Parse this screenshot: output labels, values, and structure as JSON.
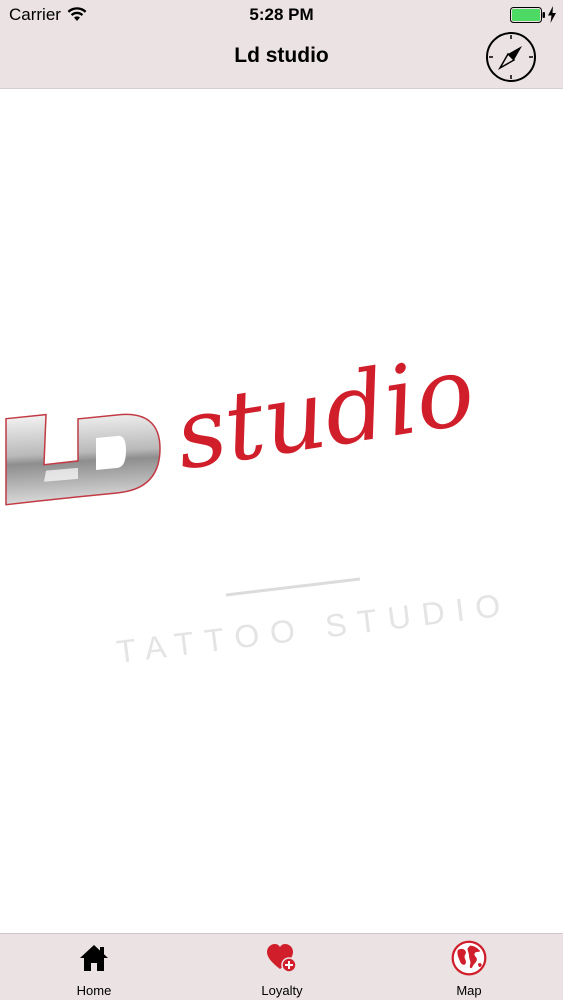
{
  "status_bar": {
    "carrier": "Carrier",
    "time": "5:28 PM",
    "battery_color": "#4cd964"
  },
  "nav_bar": {
    "title": "Ld studio",
    "compass_icon": "compass-icon"
  },
  "logo": {
    "monogram": "LD",
    "wordmark": "studio",
    "tagline": "TATTOO STUDIO",
    "wordmark_color": "#d01f2b",
    "tagline_color": "#e4e4e4"
  },
  "tab_bar": {
    "items": [
      {
        "label": "Home",
        "icon": "home-icon"
      },
      {
        "label": "Loyalty",
        "icon": "heart-plus-icon"
      },
      {
        "label": "Map",
        "icon": "globe-icon"
      }
    ],
    "accent": "#d01f2b"
  }
}
